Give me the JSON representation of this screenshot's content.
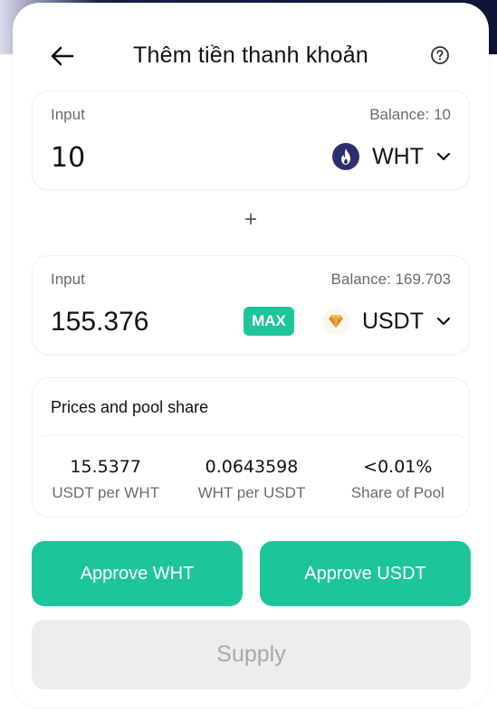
{
  "header": {
    "title": "Thêm tiền thanh khoản",
    "back_icon": "arrow-left-icon",
    "help_icon": "question-circle-icon"
  },
  "input1": {
    "label": "Input",
    "balance": "Balance: 10",
    "amount": "10",
    "token": "WHT",
    "token_icon": "heco-flame-icon"
  },
  "input2": {
    "label": "Input",
    "balance": "Balance: 169.703",
    "amount": "155.376",
    "max_label": "MAX",
    "token": "USDT",
    "token_icon": "usdt-gem-icon"
  },
  "plus_symbol": "+",
  "prices": {
    "title": "Prices and pool share",
    "stats": [
      {
        "value": "15.5377",
        "label": "USDT per WHT"
      },
      {
        "value": "0.0643598",
        "label": "WHT per USDT"
      },
      {
        "value": "<0.01%",
        "label": "Share of Pool"
      }
    ]
  },
  "actions": {
    "approve_wht": "Approve WHT",
    "approve_usdt": "Approve USDT",
    "supply": "Supply"
  },
  "colors": {
    "accent": "#1ec59a",
    "disabled_bg": "#ebedef",
    "disabled_text": "#a6a8ad",
    "wht_icon": "#2b2f6b",
    "usdt_icon": "#e5a43a"
  }
}
